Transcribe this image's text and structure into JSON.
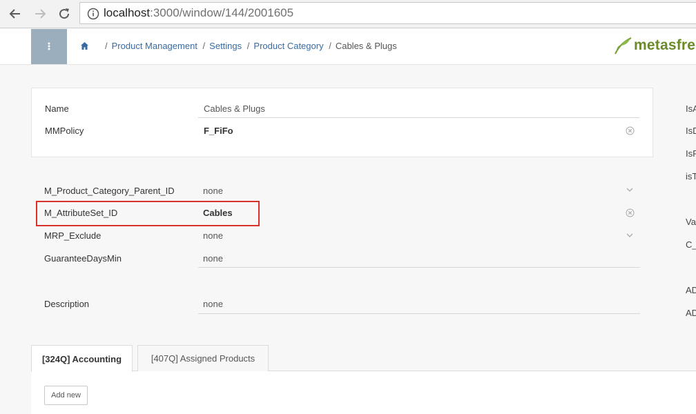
{
  "browser": {
    "url_host": "localhost",
    "url_path": ":3000/window/144/2001605"
  },
  "icons": {
    "back": "back-arrow-icon",
    "forward": "forward-arrow-icon",
    "reload": "reload-icon",
    "info": "info-icon",
    "menu": "vertical-dots-icon",
    "home": "home-icon",
    "clear": "clear-circle-x-icon",
    "dropdown": "chevron-down-icon"
  },
  "breadcrumb": {
    "items": [
      "Product Management",
      "Settings",
      "Product Category"
    ],
    "current": "Cables & Plugs"
  },
  "logo": {
    "text": "metasfre"
  },
  "colors": {
    "menu_bg": "#9aaebd",
    "link": "#3a6aa0",
    "highlight": "#d9302c",
    "logo_green": "#6b8a2a"
  },
  "panel1": {
    "name_label": "Name",
    "name_value": "Cables & Plugs",
    "mmpolicy_label": "MMPolicy",
    "mmpolicy_value": "F_FiFo"
  },
  "panel2": {
    "parent_label": "M_Product_Category_Parent_ID",
    "parent_value": "none",
    "attrset_label": "M_AttributeSet_ID",
    "attrset_value": "Cables",
    "mrp_label": "MRP_Exclude",
    "mrp_value": "none",
    "guarantee_label": "GuaranteeDaysMin",
    "guarantee_value": "none",
    "description_label": "Description",
    "description_value": "none"
  },
  "right_column": {
    "labels": [
      "IsA",
      "IsD",
      "IsF",
      "isT",
      "Va",
      "C_",
      "AD",
      "AD"
    ]
  },
  "tabs": [
    {
      "label": "[324Q] Accounting",
      "active": true
    },
    {
      "label": "[407Q] Assigned Products",
      "active": false
    }
  ],
  "actions": {
    "add_new": "Add new"
  }
}
